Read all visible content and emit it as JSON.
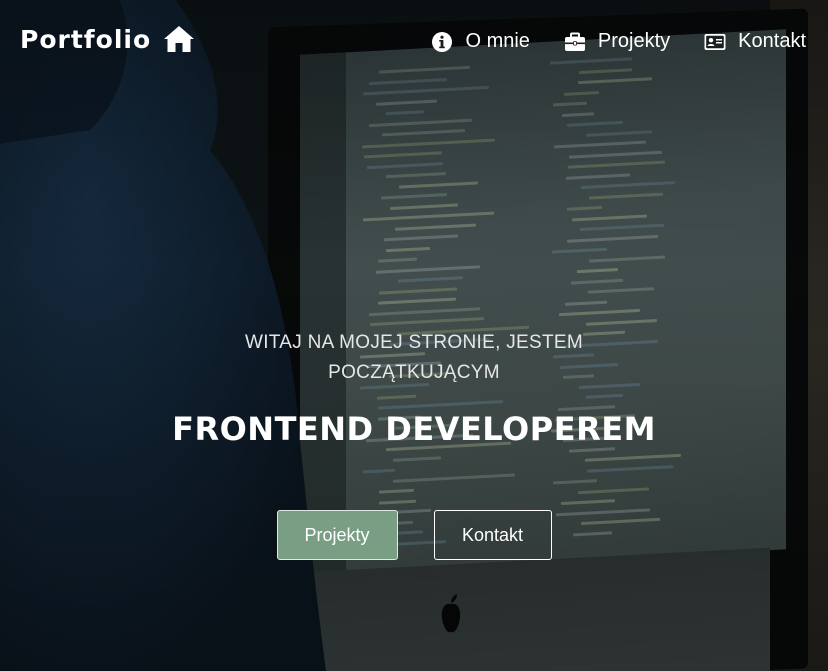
{
  "nav": {
    "brand": "Portfolio",
    "brand_icon": "home-icon",
    "links": [
      {
        "label": "O mnie",
        "icon": "info-circle-icon"
      },
      {
        "label": "Projekty",
        "icon": "briefcase-icon"
      },
      {
        "label": "Kontakt",
        "icon": "address-card-icon"
      }
    ]
  },
  "hero": {
    "subtitle": "WITAJ NA MOJEJ STRONIE, JESTEM POCZĄTKUJĄCYM",
    "title": "FRONTEND DEVELOPEREM",
    "buttons": {
      "primary": "Projekty",
      "secondary": "Kontakt"
    }
  },
  "colors": {
    "primary_button": "#7a9e84",
    "text": "#ffffff"
  }
}
